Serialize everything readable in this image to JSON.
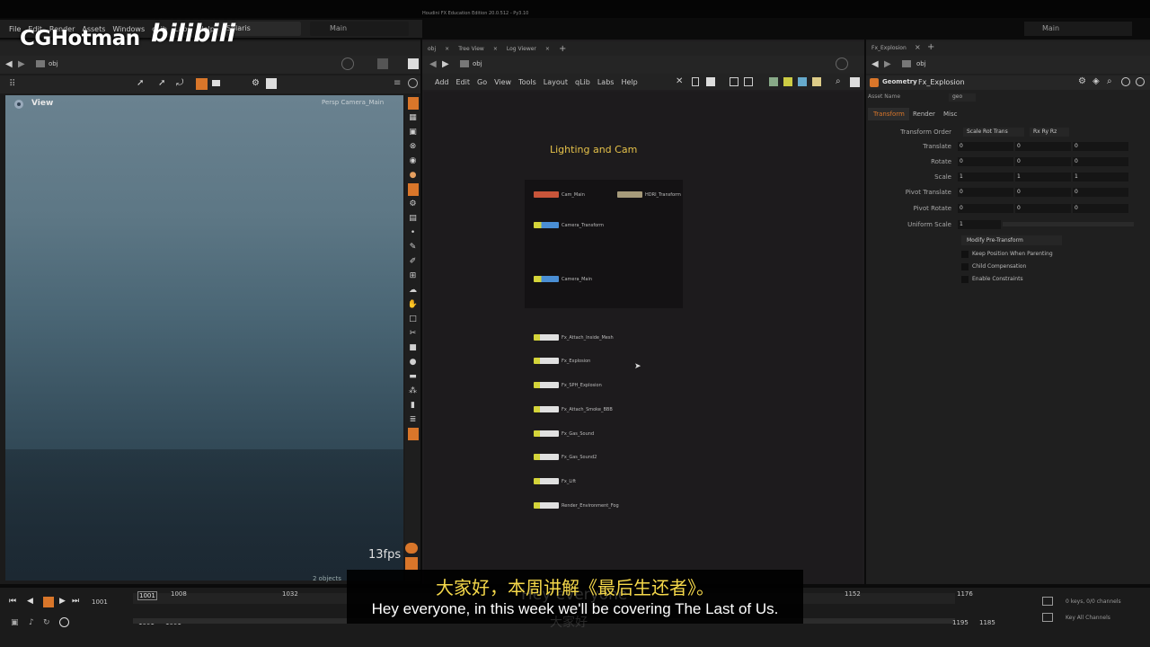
{
  "window": {
    "title": "Houdini FX Education Edition 20.0.512 - Py3.10"
  },
  "branding": {
    "logo": "CGHotman",
    "platform": "bilibili"
  },
  "menu": [
    "File",
    "Edit",
    "Render",
    "Assets",
    "Windows",
    "qLib",
    "Labs",
    "Help"
  ],
  "desktop_tabs": {
    "solaris": "Solaris",
    "main": "Main",
    "main_right": "Main"
  },
  "left_pane": {
    "path": "obj",
    "view_label": "View",
    "camera_label": "Persp  Camera_Main",
    "fps": "13fps",
    "objects": "2 objects"
  },
  "network": {
    "tabs": [
      "obj",
      "Tree View",
      "Log Viewer"
    ],
    "path": "obj",
    "menu": [
      "Add",
      "Edit",
      "Go",
      "View",
      "Tools",
      "Layout",
      "qLib",
      "Labs",
      "Help"
    ],
    "box_title": "Lighting and Cam",
    "box_nodes": [
      {
        "label": "Cam_Main"
      },
      {
        "label": "HDRI_Transform"
      },
      {
        "label": "Camera_Transform"
      },
      {
        "label": "Camera_Main"
      }
    ],
    "nodes": [
      {
        "label": "Fx_Attach_Inside_Mesh"
      },
      {
        "label": "Fx_Explosion"
      },
      {
        "label": "Fx_SPH_Explosion"
      },
      {
        "label": "Fx_Attach_Smoke_BBB"
      },
      {
        "label": "Fx_Gas_Sound"
      },
      {
        "label": "Fx_Gas_Sound2"
      },
      {
        "label": "Fx_Lift"
      },
      {
        "label": "Render_Environment_Fog"
      }
    ]
  },
  "parameters": {
    "tab": "Fx_Explosion",
    "path": "obj",
    "type": "Geometry",
    "node_name": "Fx_Explosion",
    "asset_name_label": "Asset Name",
    "asset_name_value": "geo",
    "tabs": [
      "Transform",
      "Render",
      "Misc"
    ],
    "transform_order_label": "Transform Order",
    "transform_order_value": "Scale Rot Trans",
    "rotate_order_value": "Rx Ry Rz",
    "rows": [
      {
        "label": "Translate",
        "values": [
          "0",
          "0",
          "0"
        ]
      },
      {
        "label": "Rotate",
        "values": [
          "0",
          "0",
          "0"
        ]
      },
      {
        "label": "Scale",
        "values": [
          "1",
          "1",
          "1"
        ]
      },
      {
        "label": "Pivot Translate",
        "values": [
          "0",
          "0",
          "0"
        ]
      },
      {
        "label": "Pivot Rotate",
        "values": [
          "0",
          "0",
          "0"
        ]
      }
    ],
    "uniform_scale_label": "Uniform Scale",
    "uniform_scale_value": "1",
    "modify_button": "Modify Pre-Transform",
    "checkboxes": [
      "Keep Position When Parenting",
      "Child Compensation",
      "Enable Constraints"
    ]
  },
  "timeline": {
    "frame_current": "1001",
    "ticks": [
      "1001",
      "1008",
      "1032",
      "1152",
      "1176"
    ],
    "start": "1001",
    "start2": "1001",
    "end": "1195",
    "end2": "1185",
    "keys_label": "0 keys, 0/0 channels",
    "key_all": "Key All Channels"
  },
  "subtitles": {
    "chinese": "大家好，本周讲解《最后生还者》。",
    "english": "Hey everyone, in this week we'll be covering The Last of Us.",
    "ghost": "Hey everyone",
    "ghost2": "大家好"
  },
  "colors": {
    "node_title": "#e6c24a",
    "subtitle_cn": "#f5d84a",
    "accent_orange": "#d9762a"
  }
}
